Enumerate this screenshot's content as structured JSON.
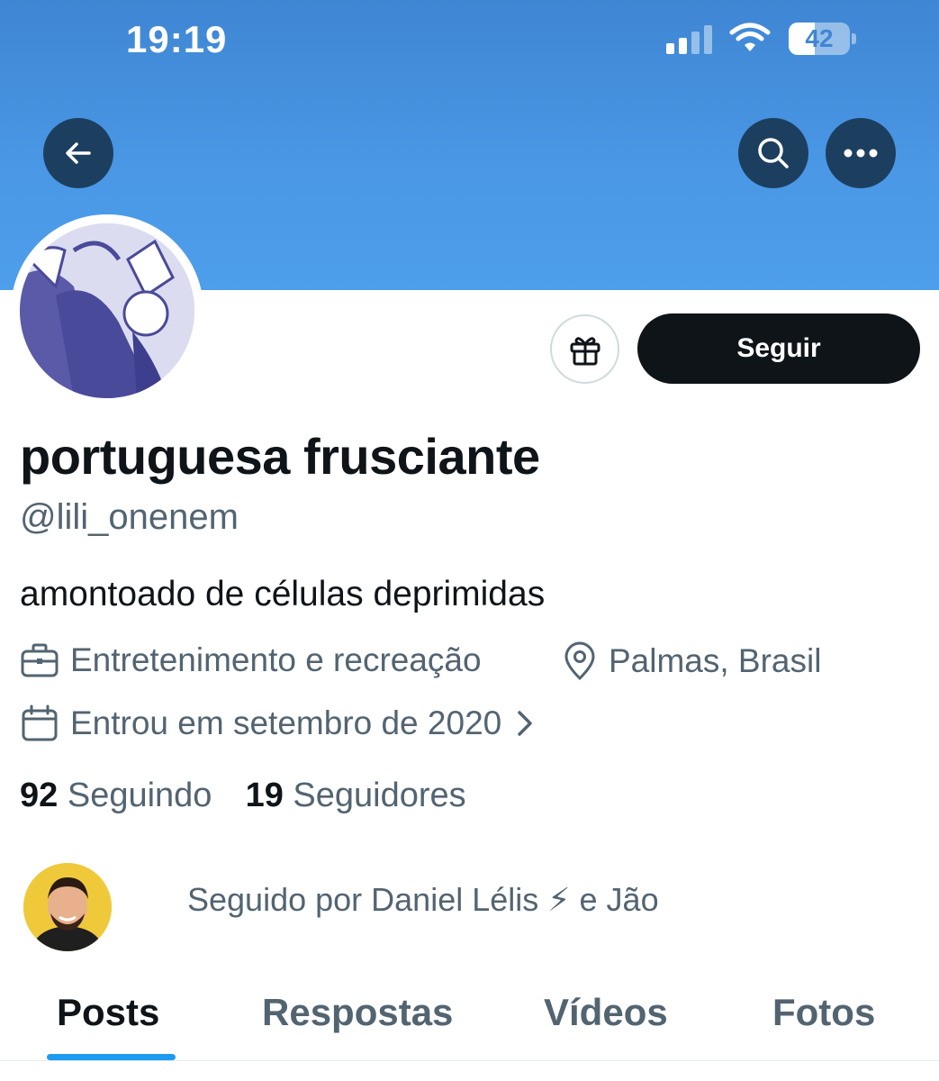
{
  "status_bar": {
    "time": "19:19",
    "battery_percent": "42",
    "battery_level": 0.42,
    "signal_bars_active": 2,
    "signal_bars_total": 4
  },
  "header": {
    "back_icon": "arrow-left-icon",
    "search_icon": "search-icon",
    "more_icon": "more-horizontal-icon",
    "banner_color": "#4a98e6"
  },
  "actions": {
    "gift_icon": "gift-icon",
    "follow_label": "Seguir"
  },
  "profile": {
    "display_name": "portuguesa frusciante",
    "handle": "@lili_onenem",
    "bio": "amontoado de células deprimidas",
    "category": "Entretenimento e recreação",
    "location": "Palmas, Brasil",
    "joined": "Entrou em setembro de 2020",
    "following_count": "92",
    "following_label": "Seguindo",
    "followers_count": "19",
    "followers_label": "Seguidores"
  },
  "followed_by": {
    "text": "Seguido por Daniel Lélis ⚡ e Jão"
  },
  "tabs": [
    {
      "label": "Posts",
      "active": true
    },
    {
      "label": "Respostas",
      "active": false
    },
    {
      "label": "Vídeos",
      "active": false
    },
    {
      "label": "Fotos",
      "active": false
    }
  ],
  "colors": {
    "accent": "#1d9bf0",
    "text_primary": "#0f1419",
    "text_secondary": "#536471",
    "follow_button": "#0f1419"
  }
}
